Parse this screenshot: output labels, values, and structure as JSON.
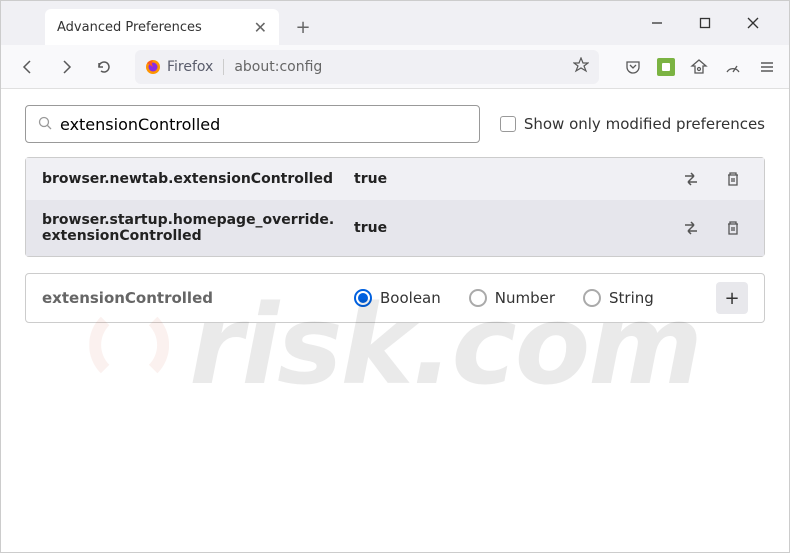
{
  "tab": {
    "title": "Advanced Preferences"
  },
  "address": {
    "brand": "Firefox",
    "url": "about:config"
  },
  "search": {
    "value": "extensionControlled",
    "checkbox_label": "Show only modified preferences"
  },
  "prefs": [
    {
      "name": "browser.newtab.extensionControlled",
      "value": "true"
    },
    {
      "name": "browser.startup.homepage_override.extensionControlled",
      "value": "true"
    }
  ],
  "new_pref": {
    "name": "extensionControlled",
    "types": [
      {
        "label": "Boolean",
        "checked": true
      },
      {
        "label": "Number",
        "checked": false
      },
      {
        "label": "String",
        "checked": false
      }
    ]
  }
}
